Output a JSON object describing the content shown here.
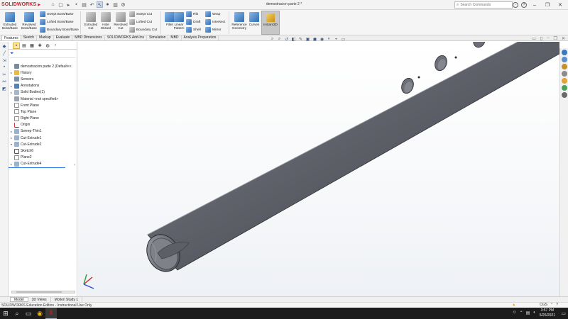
{
  "app": {
    "brand": "SOLIDWORKS",
    "document_title": "demostracion parte 2 *",
    "search_placeholder": "Search Commands"
  },
  "ribbon": {
    "big_buttons": [
      {
        "label": "Extruded\nBoss/Base"
      },
      {
        "label": "Revolved\nBoss/Base"
      },
      {
        "label": "Extruded\nCut"
      },
      {
        "label": "Hole\nWizard"
      },
      {
        "label": "Revolved\nCut"
      },
      {
        "label": "Fillet"
      },
      {
        "label": "Linear\nPattern"
      },
      {
        "label": "Reference\nGeometry"
      },
      {
        "label": "Curves"
      },
      {
        "label": "Instant3D"
      }
    ],
    "small_buttons": {
      "swept_boss": "Swept Boss/Base",
      "lofted_boss": "Lofted Boss/Base",
      "boundary_boss": "Boundary Boss/Base",
      "swept_cut": "Swept Cut",
      "lofted_cut": "Lofted Cut",
      "boundary_cut": "Boundary Cut",
      "rib": "Rib",
      "draft": "Draft",
      "shell": "Shell",
      "wrap": "Wrap",
      "intersect": "Intersect",
      "mirror": "Mirror"
    }
  },
  "tabs": [
    "Features",
    "Sketch",
    "Markup",
    "Evaluate",
    "MBD Dimensions",
    "SOLIDWORKS Add-Ins",
    "Simulation",
    "MBD",
    "Analysis Preparation"
  ],
  "feature_tree": {
    "root": "demostracion parte 2  (Default<<",
    "items": [
      {
        "label": "History",
        "icon": "folder-icon",
        "expand": "▸"
      },
      {
        "label": "Sensors",
        "icon": "sensor-icon",
        "expand": ""
      },
      {
        "label": "Annotations",
        "icon": "annotations-icon",
        "expand": "▸"
      },
      {
        "label": "Solid Bodies(1)",
        "icon": "solid-bodies-icon",
        "expand": "▸"
      },
      {
        "label": "Material <not specified>",
        "icon": "material-icon",
        "expand": ""
      },
      {
        "label": "Front Plane",
        "icon": "plane-icon",
        "expand": ""
      },
      {
        "label": "Top Plane",
        "icon": "plane-icon",
        "expand": ""
      },
      {
        "label": "Right Plane",
        "icon": "plane-icon",
        "expand": ""
      },
      {
        "label": "Origin",
        "icon": "origin-icon",
        "expand": ""
      },
      {
        "label": "Sweep-Thin1",
        "icon": "sweep-icon",
        "expand": "▸"
      },
      {
        "label": "Cut-Extrude1",
        "icon": "cut-extrude-icon",
        "expand": "▸"
      },
      {
        "label": "Cut-Extrude2",
        "icon": "cut-extrude-icon",
        "expand": "▾"
      },
      {
        "label": "Sketch6",
        "icon": "sketch-icon",
        "expand": ""
      },
      {
        "label": "Plane2",
        "icon": "plane-icon",
        "expand": ""
      },
      {
        "label": "Cut-Extrude4",
        "icon": "cut-extrude-icon",
        "expand": "▸"
      }
    ]
  },
  "bottom_tabs": [
    "Model",
    "3D Views",
    "Motion Study 1"
  ],
  "status": {
    "left": "SOLIDWORKS Education Edition - Instructional Use Only",
    "units": "CGS"
  },
  "clock": {
    "time": "3:57 PM",
    "date": "5/26/2021"
  }
}
